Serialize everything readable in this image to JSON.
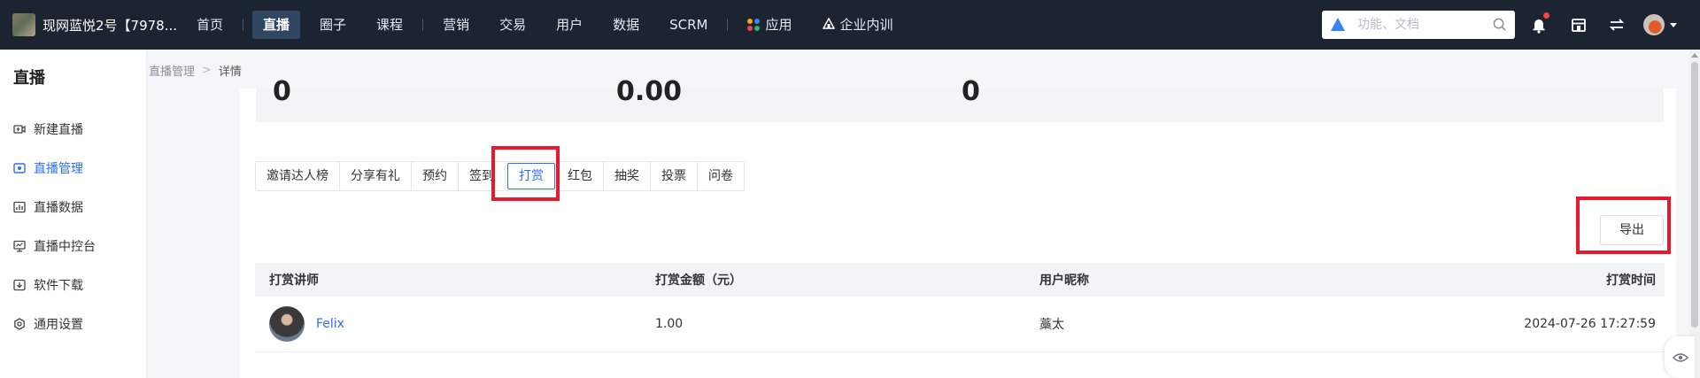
{
  "header": {
    "brand": "现网蓝悦2号【7978...",
    "nav": [
      {
        "label": "首页",
        "active": false
      },
      {
        "label": "直播",
        "active": true
      },
      {
        "label": "圈子",
        "active": false
      },
      {
        "label": "课程",
        "active": false
      },
      {
        "label": "营销",
        "active": false
      },
      {
        "label": "交易",
        "active": false
      },
      {
        "label": "用户",
        "active": false
      },
      {
        "label": "数据",
        "active": false
      },
      {
        "label": "SCRM",
        "active": false
      },
      {
        "label": "应用",
        "active": false
      },
      {
        "label": "企业内训",
        "active": false
      }
    ],
    "search_placeholder": "功能、文档",
    "icons": [
      "search-icon",
      "bell-icon",
      "store-icon",
      "switch-icon",
      "avatar",
      "chevron-down-icon"
    ]
  },
  "sidebar": {
    "title": "直播",
    "items": [
      {
        "label": "新建直播",
        "icon": "video-add-icon",
        "active": false
      },
      {
        "label": "直播管理",
        "icon": "live-manage-icon",
        "active": true
      },
      {
        "label": "直播数据",
        "icon": "chart-icon",
        "active": false
      },
      {
        "label": "直播中控台",
        "icon": "monitor-icon",
        "active": false
      },
      {
        "label": "软件下载",
        "icon": "download-icon",
        "active": false
      },
      {
        "label": "通用设置",
        "icon": "gear-icon",
        "active": false
      }
    ]
  },
  "breadcrumb": {
    "parent": "直播管理",
    "separator": ">",
    "current": "详情"
  },
  "stats": [
    "0",
    "0.00",
    "0"
  ],
  "tabs": [
    {
      "label": "邀请达人榜",
      "active": false
    },
    {
      "label": "分享有礼",
      "active": false
    },
    {
      "label": "预约",
      "active": false
    },
    {
      "label": "签到",
      "active": false
    },
    {
      "label": "打赏",
      "active": true
    },
    {
      "label": "红包",
      "active": false
    },
    {
      "label": "抽奖",
      "active": false
    },
    {
      "label": "投票",
      "active": false
    },
    {
      "label": "问卷",
      "active": false
    }
  ],
  "export_label": "导出",
  "table": {
    "headers": [
      "打赏讲师",
      "打赏金额（元）",
      "用户昵称",
      "打赏时间"
    ],
    "rows": [
      {
        "teacher": "Felix",
        "amount": "1.00",
        "nickname": "藁太",
        "time": "2024-07-26 17:27:59"
      }
    ]
  },
  "colors": {
    "nav_bg": "#1c2431",
    "accent": "#2e6fe8",
    "highlight": "#e8182e"
  }
}
